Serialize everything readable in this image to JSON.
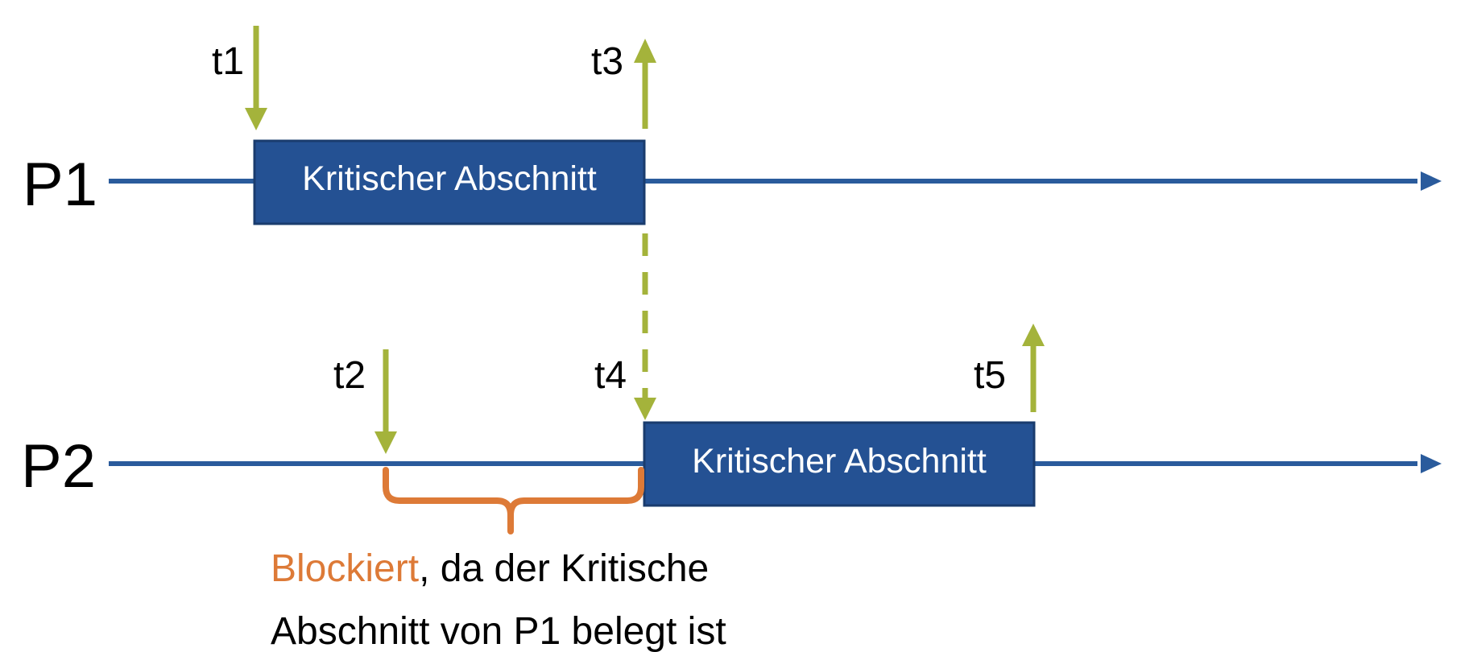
{
  "colors": {
    "timeline": "#2a5b9c",
    "box_fill": "#245193",
    "box_border": "#1a3c6e",
    "event_arrow": "#a4b33b",
    "blocked": "#dd7a37",
    "text": "#000000",
    "box_text": "#ffffff"
  },
  "processes": [
    {
      "label": "P1",
      "critical_section_label": "Kritischer Abschnitt"
    },
    {
      "label": "P2",
      "critical_section_label": "Kritischer Abschnitt"
    }
  ],
  "events": [
    {
      "label": "t1",
      "direction": "down",
      "process": "P1"
    },
    {
      "label": "t2",
      "direction": "down",
      "process": "P2"
    },
    {
      "label": "t3",
      "direction": "up",
      "process": "P1"
    },
    {
      "label": "t4",
      "direction": "down",
      "process": "P2"
    },
    {
      "label": "t5",
      "direction": "up",
      "process": "P2"
    }
  ],
  "note": {
    "highlight": "Blockiert",
    "line1_rest": ", da der Kritische",
    "line2": "Abschnitt von P1 belegt ist"
  }
}
